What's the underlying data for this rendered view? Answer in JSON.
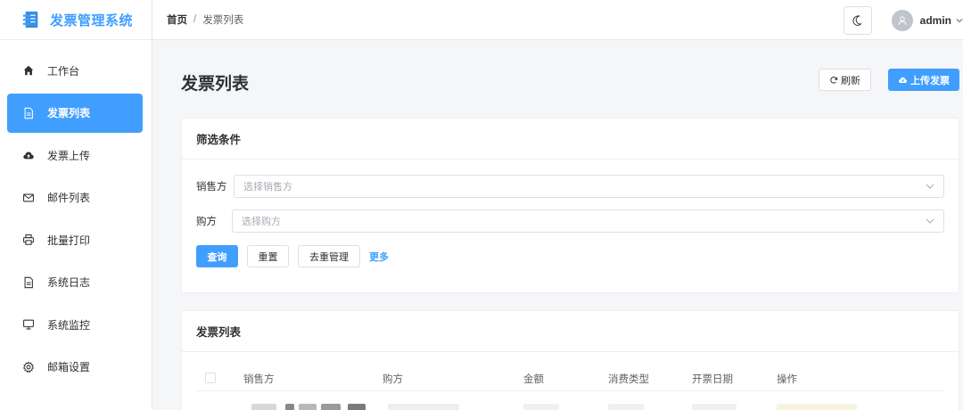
{
  "app": {
    "title": "发票管理系统",
    "logo_icon": "invoice-logo-icon",
    "accent": "#409eff"
  },
  "sidebar": {
    "items": [
      {
        "label": "工作台",
        "icon": "home-icon",
        "active": false
      },
      {
        "label": "发票列表",
        "icon": "document-icon",
        "active": true
      },
      {
        "label": "发票上传",
        "icon": "cloud-upload-icon",
        "active": false
      },
      {
        "label": "邮件列表",
        "icon": "mail-icon",
        "active": false
      },
      {
        "label": "批量打印",
        "icon": "printer-icon",
        "active": false
      },
      {
        "label": "系统日志",
        "icon": "log-document-icon",
        "active": false
      },
      {
        "label": "系统监控",
        "icon": "monitor-icon",
        "active": false
      },
      {
        "label": "邮箱设置",
        "icon": "gear-icon",
        "active": false
      }
    ]
  },
  "header": {
    "breadcrumb": {
      "home": "首页",
      "separator": "/",
      "current": "发票列表"
    },
    "theme_icon": "moon-icon",
    "username": "admin"
  },
  "page": {
    "title": "发票列表",
    "refresh_label": "刷新",
    "upload_label": "上传发票"
  },
  "filter": {
    "title": "筛选条件",
    "seller_label": "销售方",
    "seller_placeholder": "选择销售方",
    "buyer_label": "购方",
    "buyer_placeholder": "选择购方",
    "query_label": "查询",
    "reset_label": "重置",
    "dedupe_label": "去重管理",
    "more_label": "更多"
  },
  "list": {
    "title": "发票列表",
    "columns": [
      "销售方",
      "购方",
      "金额",
      "消费类型",
      "开票日期",
      "操作"
    ]
  }
}
